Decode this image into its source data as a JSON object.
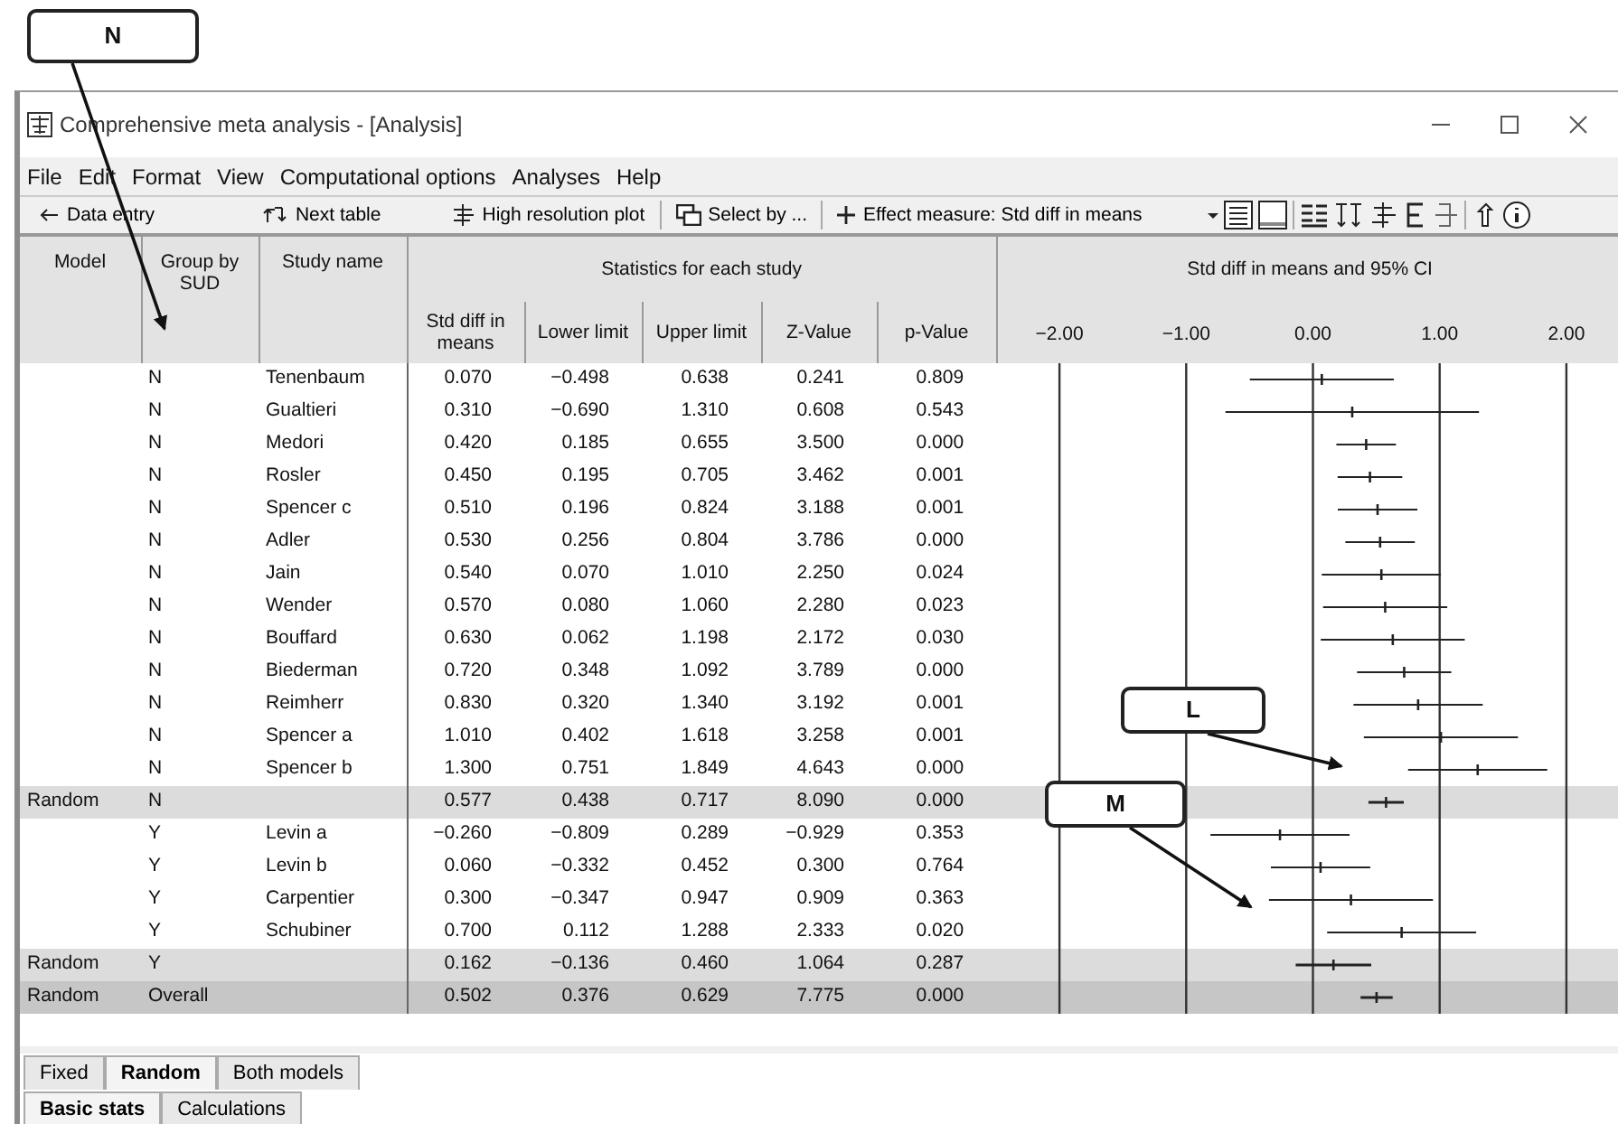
{
  "window": {
    "title": "Comprehensive meta analysis - [Analysis]"
  },
  "menu": [
    "File",
    "Edit",
    "Format",
    "View",
    "Computational options",
    "Analyses",
    "Help"
  ],
  "toolbar": [
    {
      "label": "Data entry"
    },
    {
      "label": "Next table"
    },
    {
      "label": "High resolution plot"
    },
    {
      "label": "Select by ..."
    },
    {
      "label": "Effect measure:  Std diff in means"
    }
  ],
  "table": {
    "columns": [
      "Model",
      "Group by SUD",
      "Study name"
    ],
    "group_header": "Statistics for each study",
    "stat_columns": [
      "Std diff in means",
      "Lower limit",
      "Upper limit",
      "Z-Value",
      "p-Value"
    ],
    "plot_header": "Std diff in means and 95% CI",
    "rows": [
      {
        "kind": "study",
        "model": "",
        "group": "N",
        "study": "Tenenbaum",
        "values": [
          "0.070",
          "−0.498",
          "0.638",
          "0.241",
          "0.809"
        ]
      },
      {
        "kind": "study",
        "model": "",
        "group": "N",
        "study": "Gualtieri",
        "values": [
          "0.310",
          "−0.690",
          "1.310",
          "0.608",
          "0.543"
        ]
      },
      {
        "kind": "study",
        "model": "",
        "group": "N",
        "study": "Medori",
        "values": [
          "0.420",
          "0.185",
          "0.655",
          "3.500",
          "0.000"
        ]
      },
      {
        "kind": "study",
        "model": "",
        "group": "N",
        "study": "Rosler",
        "values": [
          "0.450",
          "0.195",
          "0.705",
          "3.462",
          "0.001"
        ]
      },
      {
        "kind": "study",
        "model": "",
        "group": "N",
        "study": "Spencer c",
        "values": [
          "0.510",
          "0.196",
          "0.824",
          "3.188",
          "0.001"
        ]
      },
      {
        "kind": "study",
        "model": "",
        "group": "N",
        "study": "Adler",
        "values": [
          "0.530",
          "0.256",
          "0.804",
          "3.786",
          "0.000"
        ]
      },
      {
        "kind": "study",
        "model": "",
        "group": "N",
        "study": "Jain",
        "values": [
          "0.540",
          "0.070",
          "1.010",
          "2.250",
          "0.024"
        ]
      },
      {
        "kind": "study",
        "model": "",
        "group": "N",
        "study": "Wender",
        "values": [
          "0.570",
          "0.080",
          "1.060",
          "2.280",
          "0.023"
        ]
      },
      {
        "kind": "study",
        "model": "",
        "group": "N",
        "study": "Bouffard",
        "values": [
          "0.630",
          "0.062",
          "1.198",
          "2.172",
          "0.030"
        ]
      },
      {
        "kind": "study",
        "model": "",
        "group": "N",
        "study": "Biederman",
        "values": [
          "0.720",
          "0.348",
          "1.092",
          "3.789",
          "0.000"
        ]
      },
      {
        "kind": "study",
        "model": "",
        "group": "N",
        "study": "Reimherr",
        "values": [
          "0.830",
          "0.320",
          "1.340",
          "3.192",
          "0.001"
        ]
      },
      {
        "kind": "study",
        "model": "",
        "group": "N",
        "study": "Spencer a",
        "values": [
          "1.010",
          "0.402",
          "1.618",
          "3.258",
          "0.001"
        ]
      },
      {
        "kind": "study",
        "model": "",
        "group": "N",
        "study": "Spencer b",
        "values": [
          "1.300",
          "0.751",
          "1.849",
          "4.643",
          "0.000"
        ]
      },
      {
        "kind": "subtotal",
        "model": "Random",
        "group": "N",
        "study": "",
        "values": [
          "0.577",
          "0.438",
          "0.717",
          "8.090",
          "0.000"
        ]
      },
      {
        "kind": "study",
        "model": "",
        "group": "Y",
        "study": "Levin a",
        "values": [
          "−0.260",
          "−0.809",
          "0.289",
          "−0.929",
          "0.353"
        ]
      },
      {
        "kind": "study",
        "model": "",
        "group": "Y",
        "study": "Levin b",
        "values": [
          "0.060",
          "−0.332",
          "0.452",
          "0.300",
          "0.764"
        ]
      },
      {
        "kind": "study",
        "model": "",
        "group": "Y",
        "study": "Carpentier",
        "values": [
          "0.300",
          "−0.347",
          "0.947",
          "0.909",
          "0.363"
        ]
      },
      {
        "kind": "study",
        "model": "",
        "group": "Y",
        "study": "Schubiner",
        "values": [
          "0.700",
          "0.112",
          "1.288",
          "2.333",
          "0.020"
        ]
      },
      {
        "kind": "subtotal",
        "model": "Random",
        "group": "Y",
        "study": "",
        "values": [
          "0.162",
          "−0.136",
          "0.460",
          "1.064",
          "0.287"
        ]
      },
      {
        "kind": "overall",
        "model": "Random",
        "group": "Overall",
        "study": "",
        "values": [
          "0.502",
          "0.376",
          "0.629",
          "7.775",
          "0.000"
        ]
      }
    ],
    "plot_ticks": [
      "−2.00",
      "−1.00",
      "0.00",
      "1.00",
      "2.00"
    ]
  },
  "model_tabs": [
    {
      "label": "Fixed",
      "selected": false
    },
    {
      "label": "Random",
      "selected": true
    },
    {
      "label": "Both models",
      "selected": false
    }
  ],
  "view_tabs": [
    {
      "label": "Basic stats",
      "selected": true
    },
    {
      "label": "Calculations",
      "selected": false
    }
  ],
  "callouts": [
    {
      "label": "N"
    },
    {
      "label": "L"
    },
    {
      "label": "M"
    }
  ]
}
